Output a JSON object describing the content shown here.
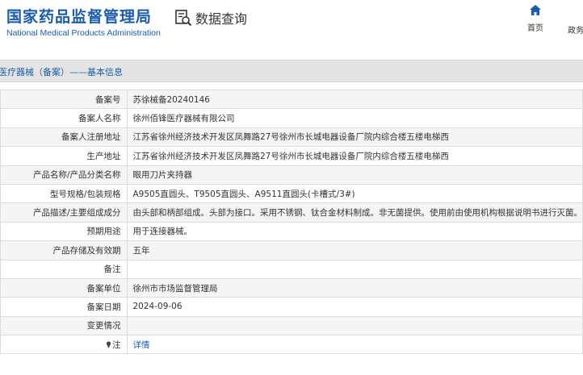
{
  "header": {
    "logo_cn": "国家药品监督管理局",
    "logo_en": "National Medical Products Administration",
    "query_title": "数据查询",
    "nav": [
      {
        "label": "首页",
        "icon": "home-icon"
      },
      {
        "label": "政务"
      }
    ]
  },
  "section": {
    "title": "医疗器械（备案）——基本信息"
  },
  "record": {
    "rows": [
      {
        "label": "备案号",
        "value": "苏徐械备20240146"
      },
      {
        "label": "备案人名称",
        "value": "徐州佰锋医疗器械有限公司"
      },
      {
        "label": "备案人注册地址",
        "value": "江苏省徐州经济技术开发区凤舞路27号徐州市长城电器设备厂院内综合楼五楼电梯西"
      },
      {
        "label": "生产地址",
        "value": "江苏省徐州经济技术开发区凤舞路27号徐州市长城电器设备厂院内综合楼五楼电梯西"
      },
      {
        "label": "产品名称/产品分类名称",
        "value": "眼用刀片夹持器"
      },
      {
        "label": "型号规格/包装规格",
        "value": "A9505直圆头、T9505直圆头、A9511直圆头(卡槽式/3#)"
      },
      {
        "label": "产品描述/主要组成成分",
        "value": "由头部和柄部组成。头部为接口。采用不锈钢、钛合金材料制成。非无菌提供。使用前由使用机构根据说明书进行灭菌。"
      },
      {
        "label": "预期用途",
        "value": "用于连接器械。"
      },
      {
        "label": "产品存储及有效期",
        "value": "五年"
      },
      {
        "label": "备注",
        "value": ""
      },
      {
        "label": "备案单位",
        "value": "徐州市市场监督管理局"
      },
      {
        "label": "备案日期",
        "value": "2024-09-06"
      },
      {
        "label": "变更情况",
        "value": ""
      }
    ],
    "note": {
      "label": "注",
      "icon": "pin-icon",
      "link": "详情"
    }
  },
  "colors": {
    "brand": "#1a5cab",
    "row_alt": "#f5f5f5",
    "section_bg": "#e4e4e4"
  }
}
